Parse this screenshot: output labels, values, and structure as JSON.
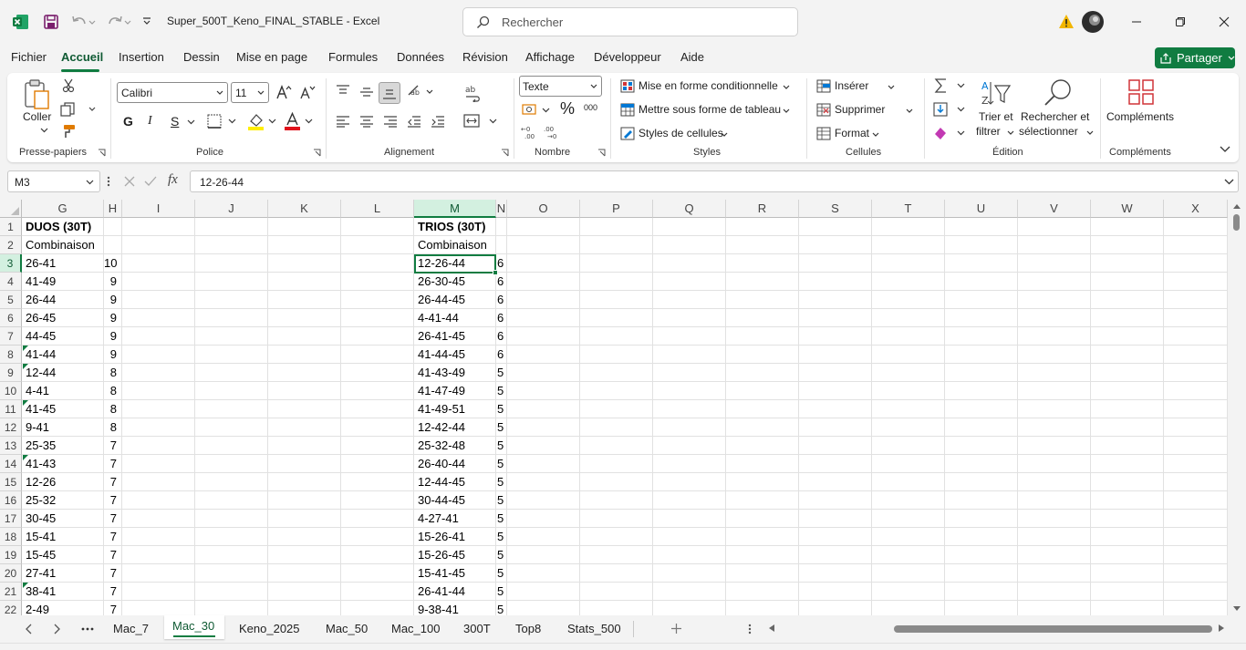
{
  "window": {
    "title": "Super_500T_Keno_FINAL_STABLE  -  Excel",
    "search_placeholder": "Rechercher"
  },
  "menu": [
    "Fichier",
    "Accueil",
    "Insertion",
    "Dessin",
    "Mise en page",
    "Formules",
    "Données",
    "Révision",
    "Affichage",
    "Développeur",
    "Aide"
  ],
  "share_label": "Partager",
  "ribbon": {
    "clipboard": {
      "paste": "Coller",
      "label": "Presse-papiers"
    },
    "font": {
      "name": "Calibri",
      "size": "11",
      "bold": "G",
      "italic": "I",
      "underline": "S",
      "label": "Police"
    },
    "alignment": {
      "label": "Alignement"
    },
    "number": {
      "format": "Texte",
      "label": "Nombre"
    },
    "styles": {
      "conditional": "Mise en forme conditionnelle",
      "table": "Mettre sous forme de tableau",
      "cell_styles": "Styles de cellules",
      "label": "Styles"
    },
    "cells": {
      "insert": "Insérer",
      "delete": "Supprimer",
      "format": "Format",
      "label": "Cellules"
    },
    "editing": {
      "sort_line1": "Trier et",
      "sort_line2": "filtrer",
      "find_line1": "Rechercher et",
      "find_line2": "sélectionner",
      "label": "Édition"
    },
    "addins": {
      "button": "Compléments",
      "label": "Compléments"
    }
  },
  "formula_bar": {
    "name_box": "M3",
    "fx": "fx",
    "value": "12-26-44"
  },
  "columns": [
    "G",
    "H",
    "I",
    "J",
    "K",
    "L",
    "M",
    "N",
    "O",
    "P",
    "Q",
    "R",
    "S",
    "T",
    "U",
    "V",
    "W",
    "X"
  ],
  "rows": [
    "1",
    "2",
    "3",
    "4",
    "5",
    "6",
    "7",
    "8",
    "9",
    "10",
    "11",
    "12",
    "13",
    "14",
    "15",
    "16",
    "17",
    "18",
    "19",
    "20",
    "21",
    "22"
  ],
  "duos": {
    "title": "DUOS (30T)",
    "header": "Combinaison",
    "combos": [
      "26-41",
      "41-49",
      "26-44",
      "26-45",
      "44-45",
      "41-44",
      "12-44",
      "4-41",
      "41-45",
      "9-41",
      "25-35",
      "41-43",
      "12-26",
      "25-32",
      "30-45",
      "15-41",
      "15-45",
      "27-41",
      "38-41",
      "2-49"
    ],
    "counts": [
      "10",
      "9",
      "9",
      "9",
      "9",
      "9",
      "8",
      "8",
      "8",
      "8",
      "7",
      "7",
      "7",
      "7",
      "7",
      "7",
      "7",
      "7",
      "7",
      "7"
    ]
  },
  "trios": {
    "title": "TRIOS (30T)",
    "header": "Combinaison",
    "combos": [
      "12-26-44",
      "26-30-45",
      "26-44-45",
      "4-41-44",
      "26-41-45",
      "41-44-45",
      "41-43-49",
      "41-47-49",
      "41-49-51",
      "12-42-44",
      "25-32-48",
      "26-40-44",
      "12-44-45",
      "30-44-45",
      "4-27-41",
      "15-26-41",
      "15-26-45",
      "15-41-45",
      "26-41-44",
      "9-38-41"
    ],
    "counts": [
      "6",
      "6",
      "6",
      "6",
      "6",
      "6",
      "5",
      "5",
      "5",
      "5",
      "5",
      "5",
      "5",
      "5",
      "5",
      "5",
      "5",
      "5",
      "5",
      "5"
    ]
  },
  "sheet_tabs": [
    "Mac_7",
    "Mac_30",
    "Keno_2025",
    "Mac_50",
    "Mac_100",
    "300T",
    "Top8",
    "Stats_500"
  ],
  "active_sheet": "Mac_30",
  "colors": {
    "accent": "#107c41",
    "selection_header": "#d3f0e0"
  }
}
